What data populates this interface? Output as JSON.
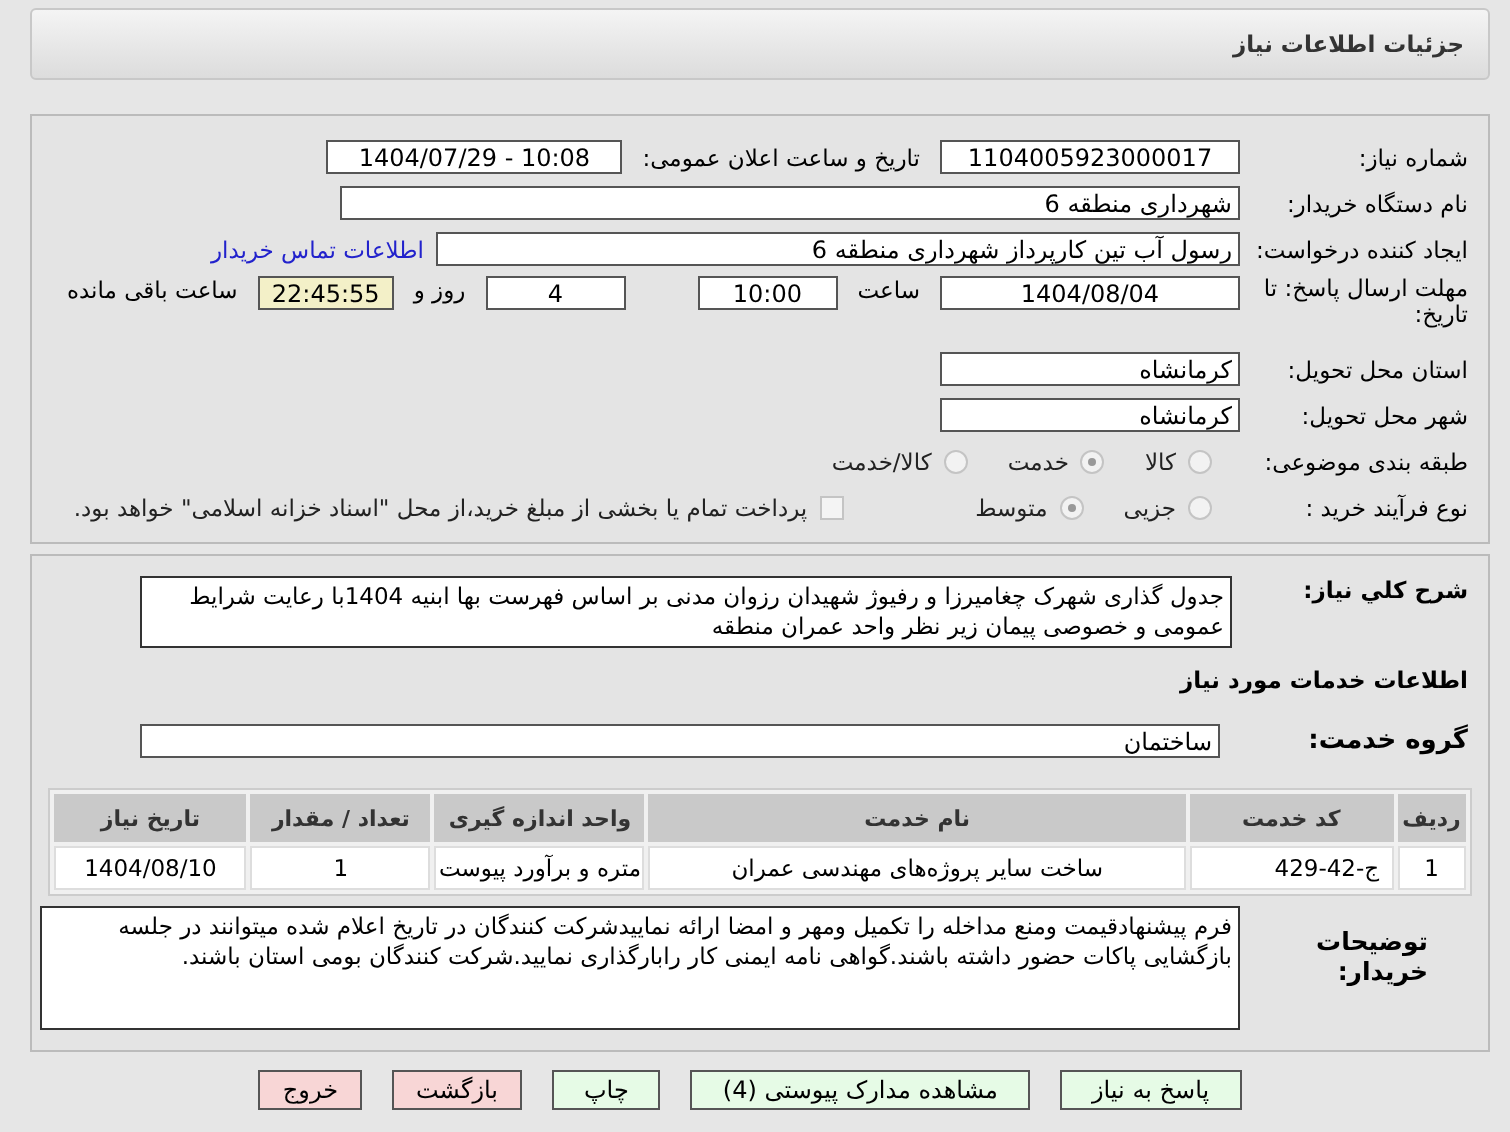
{
  "page_title": "جزئیات اطلاعات نیاز",
  "need_number": {
    "label": "شماره نیاز:",
    "value": "1104005923000017"
  },
  "announce_datetime": {
    "label": "تاریخ و ساعت اعلان عمومی:",
    "value": "1404/07/29 - 10:08"
  },
  "buyer_org": {
    "label": "نام دستگاه خریدار:",
    "value": "شهرداری منطقه 6"
  },
  "requester": {
    "label": "ایجاد کننده درخواست:",
    "value": "رسول آب تین کارپرداز شهرداری منطقه 6",
    "contact_link": "اطلاعات تماس خریدار"
  },
  "deadline": {
    "label": "مهلت ارسال پاسخ: تا تاریخ:",
    "date": "1404/08/04",
    "time_label": "ساعت",
    "time": "10:00",
    "days": "4",
    "days_label": "روز و",
    "remaining": "22:45:55",
    "remaining_label": "ساعت باقی مانده"
  },
  "delivery_province": {
    "label": "استان محل تحویل:",
    "value": "کرمانشاه"
  },
  "delivery_city": {
    "label": "شهر محل تحویل:",
    "value": "کرمانشاه"
  },
  "category": {
    "label": "طبقه بندی موضوعی:",
    "options": [
      {
        "label": "کالا",
        "selected": false
      },
      {
        "label": "خدمت",
        "selected": true
      },
      {
        "label": "کالا/خدمت",
        "selected": false
      }
    ]
  },
  "purchase_process": {
    "label": "نوع فرآیند خرید :",
    "options": [
      {
        "label": "جزیی",
        "selected": false
      },
      {
        "label": "متوسط",
        "selected": true
      }
    ],
    "treasury": {
      "label": "پرداخت تمام یا بخشی از مبلغ خرید،از محل \"اسناد خزانه اسلامی\" خواهد بود.",
      "checked": false
    }
  },
  "description": {
    "label": "شرح کلي نياز:",
    "value": "جدول گذاری شهرک چغامیرزا و رفیوژ شهیدان رزوان مدنی بر اساس فهرست بها ابنیه 1404با رعایت شرایط عمومی و خصوصی پیمان زیر نظر واحد عمران منطقه"
  },
  "services_heading": "اطلاعات خدمات مورد نیاز",
  "service_group": {
    "label": "گروه خدمت:",
    "value": "ساختمان"
  },
  "table": {
    "columns": [
      "ردیف",
      "کد خدمت",
      "نام خدمت",
      "واحد اندازه گیری",
      "تعداد / مقدار",
      "تاریخ نیاز"
    ],
    "rows": [
      {
        "cells": [
          "1",
          "ج-42-429",
          "ساخت سایر پروژه‌های مهندسی عمران",
          "متره و برآورد پیوست",
          "1",
          "1404/08/10"
        ]
      }
    ]
  },
  "buyer_notes": {
    "label": "توضیحات خریدار:",
    "value": "فرم پیشنهادقیمت ومنع مداخله را تکمیل ومهر و امضا ارائه نماییدشرکت کنندگان در تاریخ اعلام شده میتوانند در جلسه بازگشایی پاکات حضور داشته باشند.گواهی نامه ایمنی کار  رابارگذاری نمایید.شرکت کنندگان بومی استان باشند."
  },
  "buttons": [
    {
      "label": "پاسخ به نیاز",
      "kind": "action"
    },
    {
      "label": "مشاهده مدارک پیوستی (4)",
      "kind": "action"
    },
    {
      "label": "چاپ",
      "kind": "action"
    },
    {
      "label": "بازگشت",
      "kind": "danger"
    },
    {
      "label": "خروج",
      "kind": "danger"
    }
  ]
}
